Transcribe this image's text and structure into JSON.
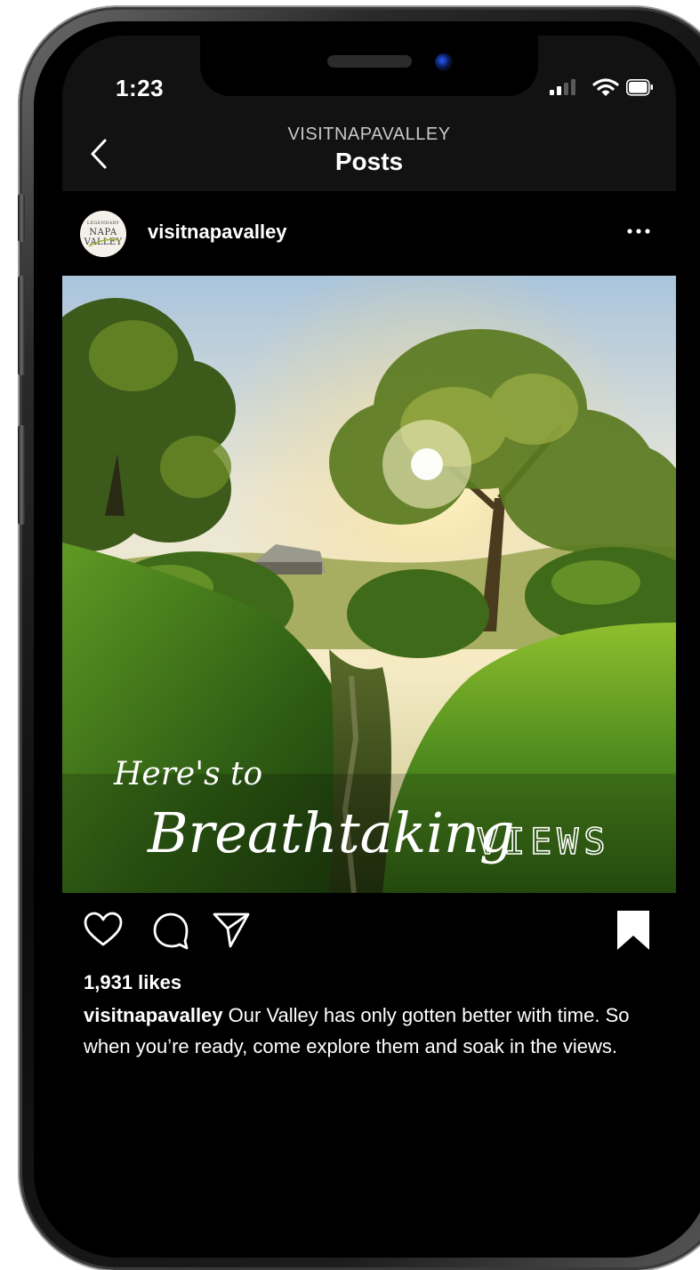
{
  "status_bar": {
    "time": "1:23",
    "icons": [
      "signal-icon",
      "wifi-icon",
      "battery-icon"
    ]
  },
  "nav": {
    "subtitle": "VISITNAPAVALLEY",
    "title": "Posts",
    "back_icon": "chevron-left-icon"
  },
  "post": {
    "username": "visitnapavalley",
    "avatar_text": [
      "LEGENDARY",
      "NAPA",
      "VALLEY"
    ],
    "more_icon": "ellipsis-icon",
    "image_overlay": {
      "line1": "Here's to",
      "line2_script": "Breathtaking",
      "line2_caps": "VIEWS"
    },
    "actions": [
      "heart-icon",
      "comment-icon",
      "share-icon",
      "bookmark-icon"
    ],
    "likes": "1,931 likes",
    "caption_user": "visitnapavalley",
    "caption_text": " Our Valley has only gotten better with time. So when you’re ready, come explore them and soak in the views."
  },
  "colors": {
    "background": "#000000",
    "nav_background": "#121212",
    "text_primary": "#ffffff",
    "text_secondary": "#c8c8c8"
  }
}
